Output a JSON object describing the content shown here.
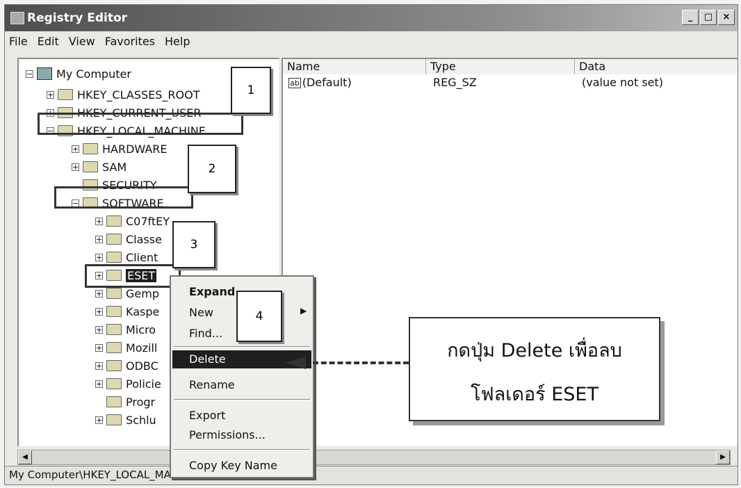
{
  "window": {
    "title": "Registry Editor"
  },
  "menubar": [
    "File",
    "Edit",
    "View",
    "Favorites",
    "Help"
  ],
  "title_buttons": {
    "minimize": "_",
    "maximize": "□",
    "close": "×"
  },
  "tree": {
    "root": "My Computer",
    "items": [
      {
        "label": "HKEY_CLASSES_ROOT",
        "exp": "+"
      },
      {
        "label": "HKEY_CURRENT_USER",
        "exp": "+"
      },
      {
        "label": "HKEY_LOCAL_MACHINE",
        "exp": "−"
      },
      {
        "label": "HARDWARE",
        "exp": "+"
      },
      {
        "label": "SAM",
        "exp": "+"
      },
      {
        "label": "SECURITY",
        "exp": ""
      },
      {
        "label": "SOFTWARE",
        "exp": "−"
      },
      {
        "label": "C07ftEY",
        "exp": "+"
      },
      {
        "label": "Classe",
        "exp": "+"
      },
      {
        "label": "Client",
        "exp": "+"
      },
      {
        "label": "ESET",
        "exp": "+"
      },
      {
        "label": "Gemp",
        "exp": "+"
      },
      {
        "label": "Kaspe",
        "exp": "+"
      },
      {
        "label": "Micro",
        "exp": "+"
      },
      {
        "label": "Mozill",
        "exp": "+"
      },
      {
        "label": "ODBC",
        "exp": "+"
      },
      {
        "label": "Policie",
        "exp": "+"
      },
      {
        "label": "Progr",
        "exp": ""
      },
      {
        "label": "Schlu",
        "exp": "+"
      }
    ]
  },
  "list": {
    "columns": [
      "Name",
      "Type",
      "Data"
    ],
    "rows": [
      {
        "name": "(Default)",
        "type": "REG_SZ",
        "data": "(value not set)"
      }
    ]
  },
  "context_menu": {
    "expand": "Expand",
    "new": "New",
    "find": "Find...",
    "delete": "Delete",
    "rename": "Rename",
    "export": "Export",
    "permissions": "Permissions...",
    "copy_key_name": "Copy Key Name"
  },
  "callouts": [
    "1",
    "2",
    "3",
    "4"
  ],
  "instruction": {
    "line1": "กดปุ่ม Delete เพื่อลบ",
    "line2": "โฟลเดอร์ ESET"
  },
  "statusbar": {
    "path": "My Computer\\HKEY_LOCAL_MACHINE\\SOFTWARE\\ESET"
  }
}
